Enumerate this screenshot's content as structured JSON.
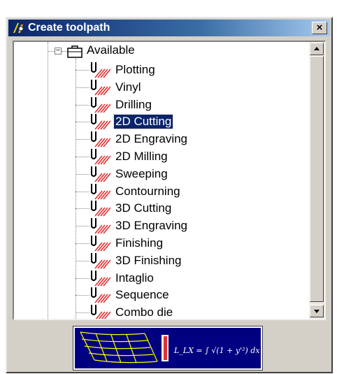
{
  "window": {
    "title": "Create toolpath",
    "close_label": "×"
  },
  "tree": {
    "root": {
      "label": "Available",
      "expander": "−"
    },
    "items": [
      {
        "label": "Plotting"
      },
      {
        "label": "Vinyl"
      },
      {
        "label": "Drilling"
      },
      {
        "label": "2D Cutting",
        "selected": true
      },
      {
        "label": "2D Engraving"
      },
      {
        "label": "2D Milling"
      },
      {
        "label": "Sweeping"
      },
      {
        "label": "Contourning"
      },
      {
        "label": "3D Cutting"
      },
      {
        "label": "3D Engraving"
      },
      {
        "label": "Finishing"
      },
      {
        "label": "3D Finishing"
      },
      {
        "label": "Intaglio"
      },
      {
        "label": "Sequence"
      },
      {
        "label": "Combo die"
      }
    ]
  },
  "banner": {
    "formula": "L_LX = ∫ √(1 + y'²) dx"
  },
  "colors": {
    "titlebar_start": "#0a246a",
    "titlebar_end": "#a6caf0",
    "selection": "#0a246a",
    "tool_red": "#e03030",
    "banner_bg": "#000080"
  }
}
